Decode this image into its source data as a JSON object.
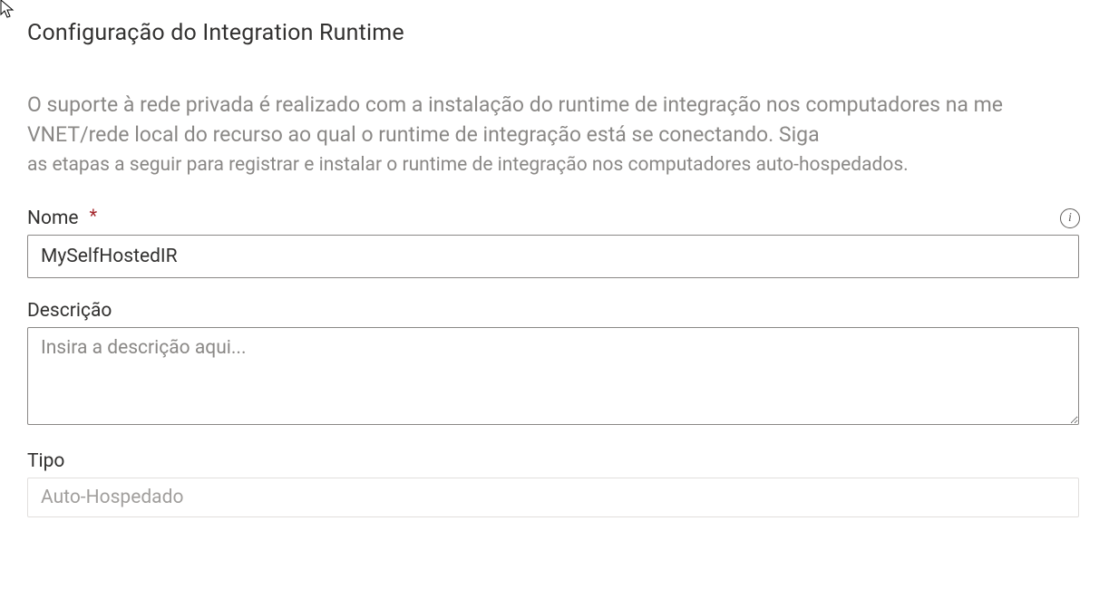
{
  "title": "Configuração do Integration Runtime",
  "description": {
    "line1": "O suporte à rede privada é realizado com a instalação do runtime de integração nos computadores na me",
    "line2": "VNET/rede local do recurso ao qual o runtime de integração está se conectando. Siga",
    "line3": "as etapas a seguir para registrar e instalar o runtime de integração nos computadores auto-hospedados."
  },
  "form": {
    "name": {
      "label": "Nome",
      "value": "MySelfHostedIR",
      "required_marker": "*"
    },
    "description_field": {
      "label": "Descrição",
      "placeholder": "Insira a descrição aqui...",
      "value": ""
    },
    "type": {
      "label": "Tipo",
      "value": "Auto-Hospedado"
    }
  },
  "icons": {
    "info_glyph": "i"
  }
}
